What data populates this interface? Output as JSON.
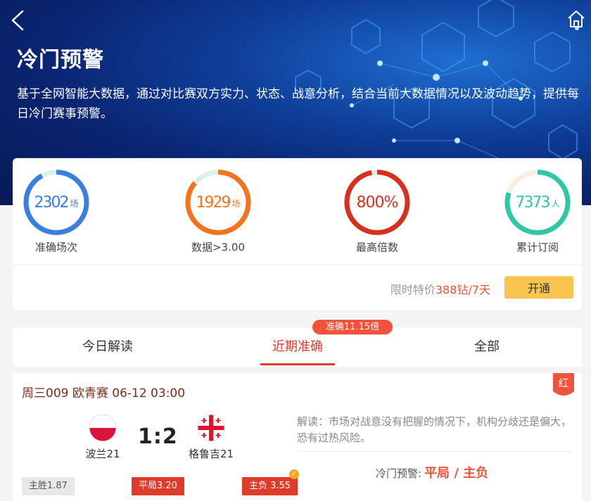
{
  "header": {
    "title": "冷门预警",
    "description": "基于全网智能大数据，通过对比赛双方实力、状态、战意分析，结合当前大数据情况以及波动趋势，提供每日冷门赛事预警。"
  },
  "stats": [
    {
      "value": "2302",
      "unit": "场",
      "label": "准确场次",
      "color": "#3a7fe0",
      "fill": 0.92
    },
    {
      "value": "1929",
      "unit": "场",
      "label": "数据>3.00",
      "color": "#f5731d",
      "fill": 0.86
    },
    {
      "value": "800%",
      "unit": "",
      "label": "最高倍数",
      "color": "#d8301e",
      "fill": 0.97
    },
    {
      "value": "7373",
      "unit": "人",
      "label": "累计订阅",
      "color": "#2ec9a3",
      "fill": 0.8
    }
  ],
  "subscribe": {
    "price_prefix": "限时特价",
    "price_value": "388钻/7天",
    "button_label": "开通"
  },
  "tabs": {
    "items": [
      "今日解读",
      "近期准确",
      "全部"
    ],
    "active_index": 1,
    "badge": "准确11.15倍"
  },
  "match": {
    "header": "周三009 欧青赛 06-12 03:00",
    "flag_label": "红",
    "home_team": "波兰21",
    "away_team": "格鲁吉21",
    "score": "1:2",
    "analysis": "解读：市场对战意没有把握的情况下，机构分歧还是偏大，恐有过热风险。",
    "warning_label": "冷门预警:",
    "warning_result": "平局 / 主负",
    "odds": [
      {
        "label": "主胜1.87",
        "highlight": false
      },
      {
        "label": "平局3.20",
        "highlight": true
      },
      {
        "label": "主负 3.55",
        "highlight": true
      }
    ]
  },
  "colors": {
    "accent": "#e03a2a",
    "button": "#f9c54f",
    "header_bg": "#0a2470"
  }
}
